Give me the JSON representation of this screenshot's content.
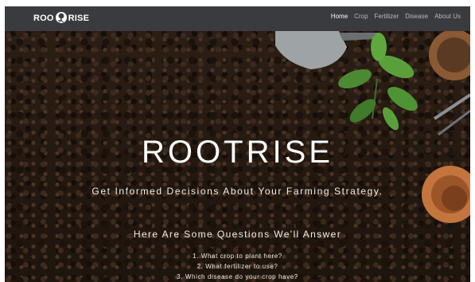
{
  "navbar": {
    "logo_left": "ROO",
    "logo_right": "RISE",
    "logo_icon": "tree-roots-icon",
    "links": [
      {
        "label": "Home",
        "active": true
      },
      {
        "label": "Crop",
        "active": false
      },
      {
        "label": "Fertilizer",
        "active": false
      },
      {
        "label": "Disease",
        "active": false
      },
      {
        "label": "About Us",
        "active": false
      }
    ]
  },
  "hero": {
    "title": "ROOTRISE",
    "subtitle": "Get Informed Decisions About Your Farming Strategy.",
    "questions_heading": "Here Are Some Questions We'll Answer",
    "questions": [
      "1. What crop to plant here?",
      "2. What fertilizer to use?",
      "3. Which disease do your crop have?"
    ]
  },
  "colors": {
    "navbar_bg": "#3a3b3f",
    "soil": "#2a1d14",
    "text": "#ffffff"
  }
}
